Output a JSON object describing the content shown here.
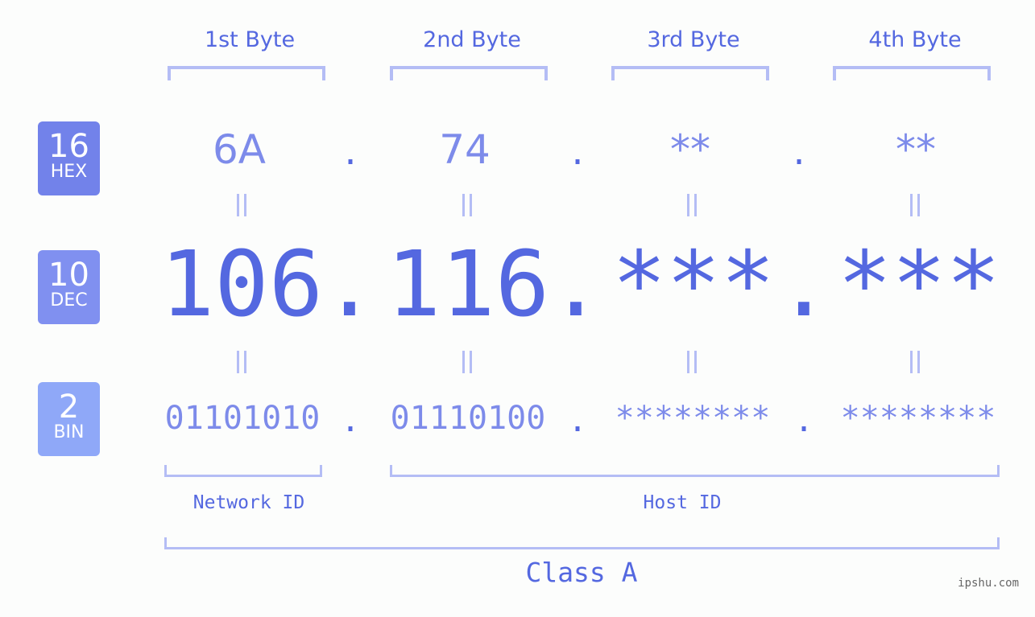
{
  "byte_headers": [
    "1st Byte",
    "2nd Byte",
    "3rd Byte",
    "4th Byte"
  ],
  "badges": [
    {
      "number": "16",
      "label": "HEX",
      "color": "#7282ea"
    },
    {
      "number": "10",
      "label": "DEC",
      "color": "#8090f0"
    },
    {
      "number": "2",
      "label": "BIN",
      "color": "#8fa8f8"
    }
  ],
  "hex": [
    "6A",
    "74",
    "**",
    "**"
  ],
  "dec": [
    "106",
    "116",
    "***",
    "***"
  ],
  "bin": [
    "01101010",
    "01110100",
    "********",
    "********"
  ],
  "separator": ".",
  "equals": "=",
  "network_id_label": "Network ID",
  "host_id_label": "Host ID",
  "class_label": "Class A",
  "watermark": "ipshu.com",
  "colors": {
    "accent": "#5468e0",
    "light": "#7d8bea",
    "bracket": "#b4bdf5"
  }
}
